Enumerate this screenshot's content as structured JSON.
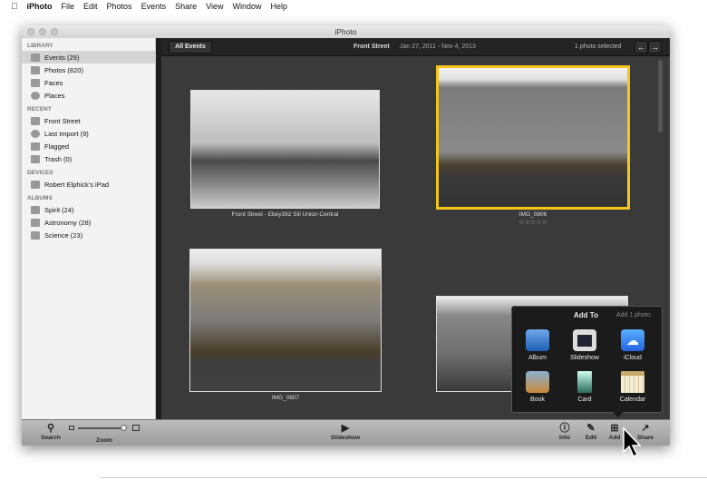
{
  "menubar": {
    "apple": "",
    "items": [
      "iPhoto",
      "File",
      "Edit",
      "Photos",
      "Events",
      "Share",
      "View",
      "Window",
      "Help"
    ]
  },
  "window": {
    "title": "iPhoto"
  },
  "sidebar": {
    "sections": [
      {
        "title": "LIBRARY",
        "items": [
          {
            "label": "Events (29)",
            "icon": "events-palm-icon",
            "selected": true
          },
          {
            "label": "Photos (820)",
            "icon": "photos-icon"
          },
          {
            "label": "Faces",
            "icon": "faces-icon"
          },
          {
            "label": "Places",
            "icon": "globe-icon"
          }
        ]
      },
      {
        "title": "RECENT",
        "items": [
          {
            "label": "Front Street",
            "icon": "events-palm-icon"
          },
          {
            "label": "Last Import (9)",
            "icon": "clock-icon"
          },
          {
            "label": "Flagged",
            "icon": "flag-icon"
          },
          {
            "label": "Trash (0)",
            "icon": "trash-icon"
          }
        ]
      },
      {
        "title": "DEVICES",
        "items": [
          {
            "label": "Robert Elphick's iPad",
            "icon": "ipad-icon"
          }
        ]
      },
      {
        "title": "ALBUMS",
        "items": [
          {
            "label": "Spirit (24)",
            "icon": "album-icon"
          },
          {
            "label": "Astronomy (28)",
            "icon": "album-icon"
          },
          {
            "label": "Science (23)",
            "icon": "album-icon"
          }
        ]
      }
    ]
  },
  "toolbar": {
    "all_events": "All Events",
    "event_name": "Front Street",
    "date_range": "Jan 27, 2011 - Nov 4, 2013",
    "selection": "1 photo selected",
    "prev": "←",
    "next": "→"
  },
  "photos": [
    {
      "caption": "Front Street - Ebey392 Sill Union Central",
      "selected": false
    },
    {
      "caption": "IMG_0806",
      "rating": "☆☆☆☆☆",
      "selected": true
    },
    {
      "caption": "IMG_0807",
      "selected": false
    },
    {
      "caption": "",
      "selected": false
    }
  ],
  "accent": "#f5c518",
  "popup": {
    "title": "Add To",
    "subtitle": "Add 1 photo",
    "items": [
      "Album",
      "Slideshow",
      "iCloud",
      "Book",
      "Card",
      "Calendar"
    ]
  },
  "bottom": {
    "search": "Search",
    "zoom": "Zoom",
    "zoom_level": 0.95,
    "slideshow": "Slideshow",
    "info": "Info",
    "edit": "Edit",
    "add": "Add",
    "share": "Share"
  }
}
